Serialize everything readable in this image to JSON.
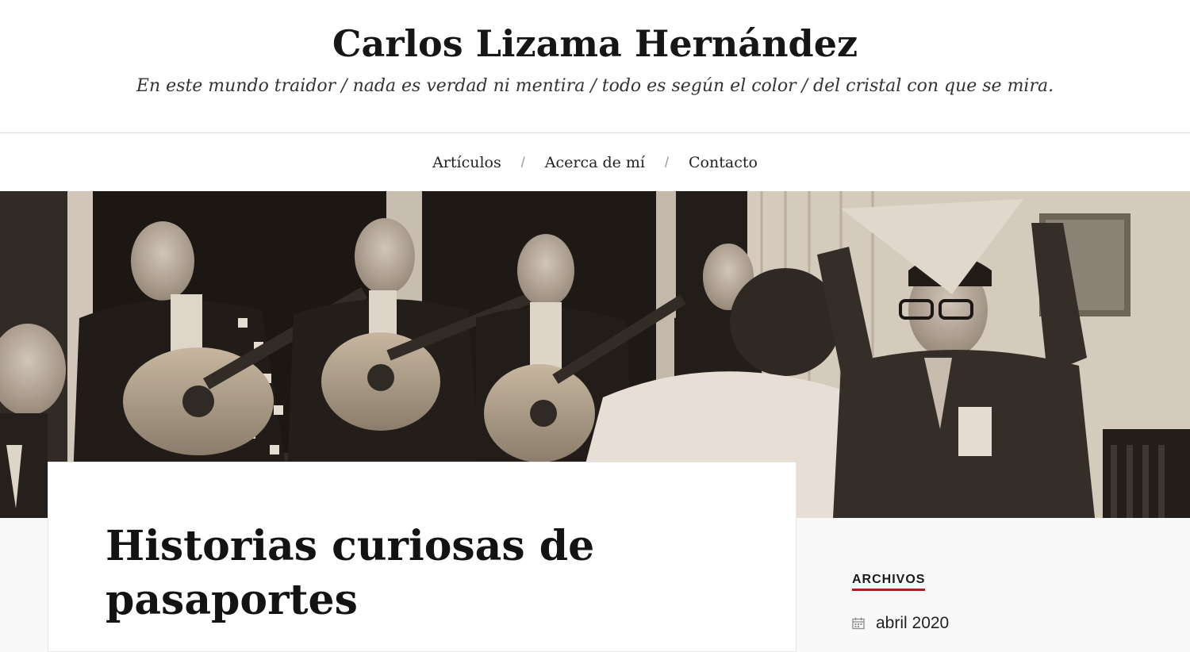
{
  "site": {
    "title": "Carlos Lizama Hernández",
    "tagline": "En este mundo traidor / nada es verdad ni mentira / todo es según el color / del cristal con que se mira."
  },
  "nav": {
    "items": [
      {
        "label": "Artículos"
      },
      {
        "label": "Acerca de mí"
      },
      {
        "label": "Contacto"
      }
    ],
    "separator": "/"
  },
  "hero": {
    "description_icon": "sepia-photo-musicians-and-dancers"
  },
  "article": {
    "title_line1": "Historias curiosas de",
    "title_line2": "pasaportes"
  },
  "sidebar": {
    "widget_title": "ARCHIVOS",
    "archives": [
      {
        "label": "abril 2020",
        "icon": "calendar-icon"
      }
    ]
  },
  "colors": {
    "accent": "#a3261c",
    "header_bg": "#ffffff",
    "page_bg": "#f9f9f9"
  }
}
